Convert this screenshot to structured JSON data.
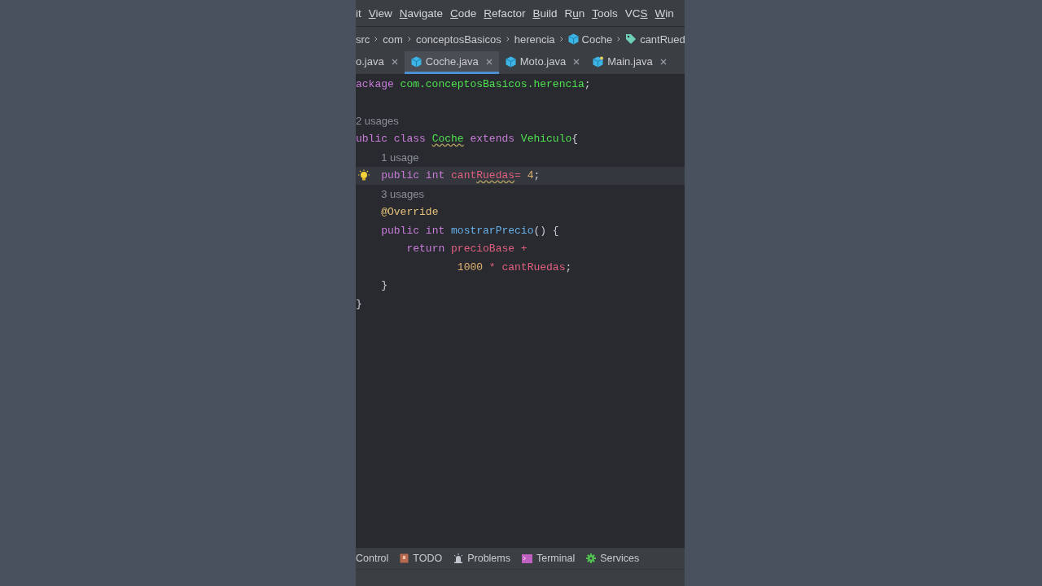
{
  "menu": [
    {
      "before": "it"
    },
    {
      "key": "V",
      "after": "iew"
    },
    {
      "key": "N",
      "after": "avigate"
    },
    {
      "key": "C",
      "after": "ode"
    },
    {
      "key": "R",
      "after": "efactor"
    },
    {
      "key": "B",
      "after": "uild"
    },
    {
      "before": "R",
      "key": "u",
      "after": "n"
    },
    {
      "key": "T",
      "after": "ools"
    },
    {
      "before": "VC",
      "key": "S"
    },
    {
      "key": "W",
      "after": "in"
    }
  ],
  "breadcrumbs": [
    {
      "label": "src",
      "kind": "folder"
    },
    {
      "label": "com",
      "kind": "folder"
    },
    {
      "label": "conceptosBasicos",
      "kind": "folder"
    },
    {
      "label": "herencia",
      "kind": "folder"
    },
    {
      "label": "Coche",
      "kind": "class"
    },
    {
      "label": "cantRued",
      "kind": "field"
    }
  ],
  "tabs": [
    {
      "label": "o.java",
      "kind": "file",
      "selected": false
    },
    {
      "label": "Coche.java",
      "kind": "class",
      "selected": true
    },
    {
      "label": "Moto.java",
      "kind": "class",
      "selected": false
    },
    {
      "label": "Main.java",
      "kind": "main-class",
      "selected": false
    }
  ],
  "code": [
    {
      "current": false,
      "bulb": false,
      "tokens": [
        {
          "t": "ackage ",
          "kind": "kw"
        },
        {
          "t": "com.conceptosBasicos.herencia",
          "kind": "pkg"
        },
        {
          "t": ";",
          "kind": "punct"
        }
      ]
    },
    {
      "current": false,
      "bulb": false
    },
    {
      "current": false,
      "bulb": false,
      "tokens": [
        {
          "t": "2 usages",
          "kind": "hint"
        }
      ]
    },
    {
      "current": false,
      "bulb": false,
      "tokens": [
        {
          "t": "ublic class ",
          "kind": "kw"
        },
        {
          "t": "Coche",
          "kind": "pkg",
          "squiggle": true
        },
        {
          "t": " extends ",
          "kind": "kw"
        },
        {
          "t": "Vehiculo",
          "kind": "pkg"
        },
        {
          "t": "{",
          "kind": "punct"
        }
      ]
    },
    {
      "current": false,
      "bulb": false,
      "tokens": [
        {
          "t": "    1 usage",
          "kind": "hint"
        }
      ]
    },
    {
      "current": true,
      "bulb": true,
      "tokens": [
        {
          "t": "    public int ",
          "kind": "kw"
        },
        {
          "t": "cant",
          "kind": "field"
        },
        {
          "t": "Ruedas",
          "kind": "field",
          "squiggle": true
        },
        {
          "t": "= ",
          "kind": "op"
        },
        {
          "t": "4",
          "kind": "num"
        },
        {
          "t": ";",
          "kind": "punct"
        }
      ]
    },
    {
      "current": false,
      "bulb": false,
      "tokens": [
        {
          "t": "    3 usages",
          "kind": "hint"
        }
      ]
    },
    {
      "current": false,
      "bulb": false,
      "tokens": [
        {
          "t": "    @Override",
          "kind": "anno"
        }
      ]
    },
    {
      "current": false,
      "bulb": false,
      "tokens": [
        {
          "t": "    public int ",
          "kind": "kw"
        },
        {
          "t": "mostrarPrecio",
          "kind": "method"
        },
        {
          "t": "() {",
          "kind": "punct"
        }
      ]
    },
    {
      "current": false,
      "bulb": false,
      "tokens": [
        {
          "t": "        return ",
          "kind": "kw"
        },
        {
          "t": "precioBase ",
          "kind": "field"
        },
        {
          "t": "+",
          "kind": "op"
        }
      ]
    },
    {
      "current": false,
      "bulb": false,
      "tokens": [
        {
          "t": "                1000 ",
          "kind": "num"
        },
        {
          "t": "* ",
          "kind": "op"
        },
        {
          "t": "cantRuedas",
          "kind": "field"
        },
        {
          "t": ";",
          "kind": "punct"
        }
      ]
    },
    {
      "current": false,
      "bulb": false,
      "tokens": [
        {
          "t": "    }",
          "kind": "punct"
        }
      ]
    },
    {
      "current": false,
      "bulb": false,
      "tokens": [
        {
          "t": "}",
          "kind": "punct"
        }
      ]
    }
  ],
  "tool_windows": [
    {
      "label": "Control",
      "kind": "plain"
    },
    {
      "label": "TODO",
      "kind": "todo"
    },
    {
      "label": "Problems",
      "kind": "problems"
    },
    {
      "label": "Terminal",
      "kind": "terminal"
    },
    {
      "label": "Services",
      "kind": "services"
    }
  ]
}
